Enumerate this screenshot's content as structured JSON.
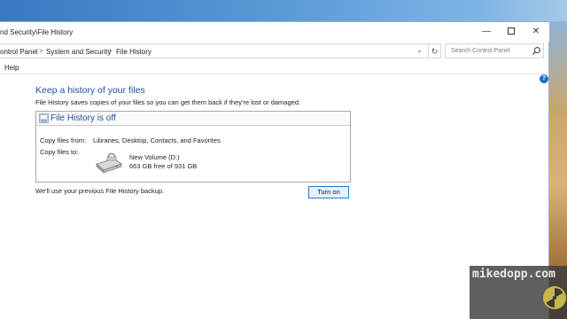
{
  "window": {
    "title": "nd Security\\File History",
    "controls": {
      "minimize": "—",
      "maximize": "",
      "close": "✕"
    }
  },
  "address_bar": {
    "breadcrumbs": [
      "ontrol Panel",
      "System and Security",
      "File History"
    ],
    "separator": ">",
    "dropdown_glyph": "⌄",
    "refresh_glyph": "↻"
  },
  "search": {
    "placeholder": "Search Control Panel"
  },
  "menu": {
    "items": [
      "Help"
    ]
  },
  "help_icon": "?",
  "main": {
    "title": "Keep a history of your files",
    "description": "File History saves copies of your files so you can get them back if they're lost or damaged.",
    "status_box": {
      "title": "File History is off",
      "copy_from_label": "Copy files from:",
      "copy_from_value": "Libraries, Desktop, Contacts, and Favorites",
      "copy_to_label": "Copy files to:",
      "drive_name": "New Volume (D:)",
      "drive_free": "663 GB free of 931 GB"
    },
    "note": "We'll use your previous File History backup.",
    "turn_on_label": "Turn on"
  },
  "watermark": {
    "text": "mikedopp.com"
  },
  "colors": {
    "accent": "#1e4fa0",
    "button_border": "#2b79d0",
    "button_bg": "#e5f1fb"
  },
  "icons": [
    "close-icon",
    "maximize-icon",
    "minimize-icon",
    "chevron-down-icon",
    "refresh-icon",
    "search-icon",
    "help-icon",
    "file-history-icon",
    "external-drive-icon",
    "radiation-icon"
  ]
}
